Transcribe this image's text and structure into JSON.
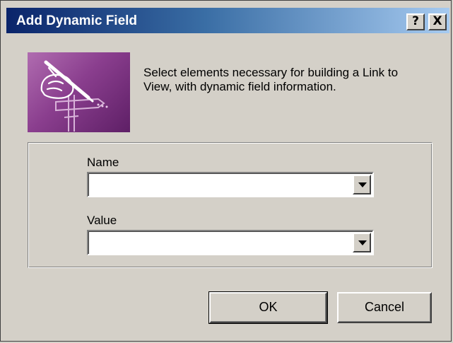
{
  "window": {
    "title": "Add Dynamic Field",
    "help_label": "?",
    "close_label": "X"
  },
  "header": {
    "description": "Select elements necessary for building a Link to View, with dynamic field information."
  },
  "form": {
    "name_label": "Name",
    "name_value": "",
    "value_label": "Value",
    "value_value": ""
  },
  "buttons": {
    "ok_label": "OK",
    "cancel_label": "Cancel"
  },
  "colors": {
    "titlebar_start": "#0a246a",
    "titlebar_end": "#a6caf0",
    "dialog_face": "#d4d0c8",
    "logo_purple": "#8a3e8e"
  }
}
